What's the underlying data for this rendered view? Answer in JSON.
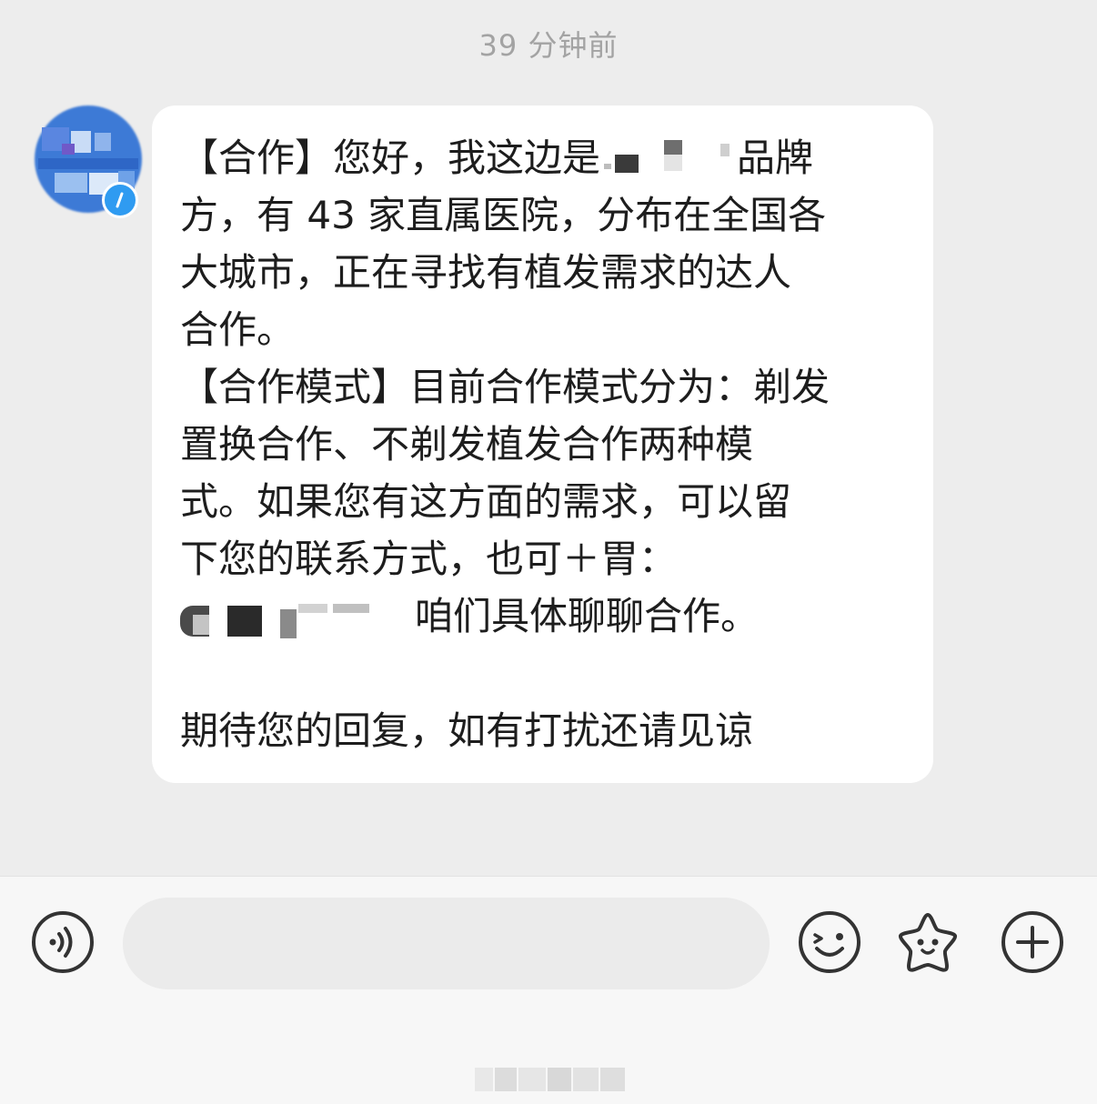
{
  "chat": {
    "timestamp": "39 分钟前",
    "message": {
      "lines": [
        {
          "before": "【合作】您好，我这边是",
          "after": "品牌"
        },
        {
          "text": "方，有 43 家直属医院，分布在全国各"
        },
        {
          "text": "大城市，正在寻找有植发需求的达人"
        },
        {
          "text": "合作。"
        },
        {
          "text": "【合作模式】目前合作模式分为：剃发"
        },
        {
          "text": "置换合作、不剃发植发合作两种模"
        },
        {
          "text": "式。如果您有这方面的需求，可以留"
        },
        {
          "text": "下您的联系方式，也可＋胃："
        },
        {
          "after": "咱们具体聊聊合作。"
        },
        {
          "text": ""
        },
        {
          "text": "期待您的回复，如有打扰还请见谅"
        }
      ]
    }
  },
  "input_bar": {
    "text_value": "",
    "icons": {
      "voice": "voice-input-icon",
      "emoji": "emoji-icon",
      "sticker": "sticker-icon",
      "plus": "plus-icon"
    }
  },
  "colors": {
    "chat_bg": "#ededed",
    "bubble_bg": "#ffffff",
    "text": "#1d1d1d",
    "timestamp": "#a3a3a3",
    "icon_stroke": "#333333",
    "verified_badge": "#2f9bf1",
    "input_bar_bg": "#f7f7f7",
    "input_field_bg": "#ebebeb"
  }
}
